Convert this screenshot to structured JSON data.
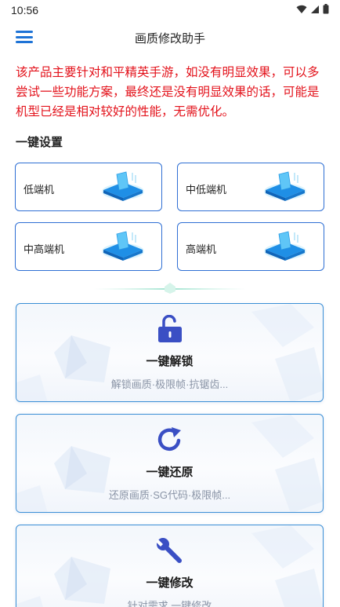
{
  "status": {
    "time": "10:56"
  },
  "header": {
    "title": "画质修改助手"
  },
  "notice": "该产品主要针对和平精英手游，如没有明显效果，可以多尝试一些功能方案，最终还是没有明显效果的话，可能是机型已经是相对较好的性能，无需优化。",
  "presets": {
    "title": "一键设置",
    "items": [
      {
        "label": "低端机"
      },
      {
        "label": "中低端机"
      },
      {
        "label": "中高端机"
      },
      {
        "label": "高端机"
      }
    ]
  },
  "cards": [
    {
      "title": "一键解锁",
      "subtitle": "解锁画质·极限帧·抗锯齿...",
      "icon": "unlock-icon"
    },
    {
      "title": "一键还原",
      "subtitle": "还原画质·SG代码·极限帧...",
      "icon": "refresh-icon"
    },
    {
      "title": "一键修改",
      "subtitle": "针对需求 一键修改",
      "icon": "wrench-icon"
    }
  ],
  "colors": {
    "accent": "#1e73d6",
    "notice": "#e3121b",
    "border": "#2f6fd4"
  }
}
